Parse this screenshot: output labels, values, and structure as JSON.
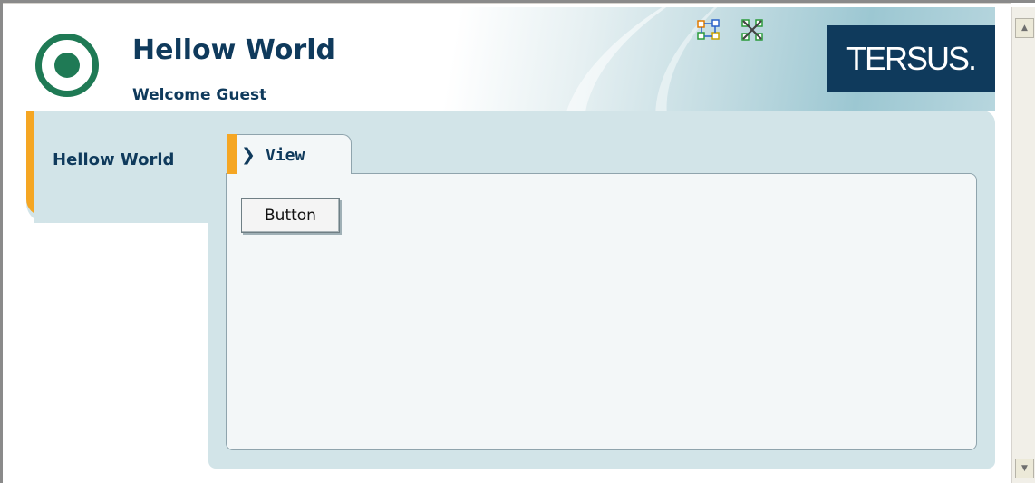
{
  "header": {
    "title": "Hellow World",
    "welcome": "Welcome Guest",
    "brand": "TERSUS.",
    "icons": [
      "refresh-network-icon",
      "disconnected-network-icon"
    ]
  },
  "nav": {
    "items": [
      {
        "label": "Hellow World",
        "selected": true
      }
    ]
  },
  "tabs": [
    {
      "label": "View",
      "active": true
    }
  ],
  "main": {
    "button_label": "Button"
  },
  "colors": {
    "navy": "#0f3a5c",
    "accent": "#f5a623",
    "panel": "#d2e4e8",
    "logo_green": "#1f7a55"
  }
}
